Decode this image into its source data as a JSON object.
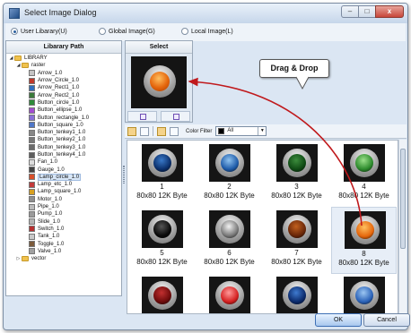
{
  "window": {
    "title": "Select Image Dialog",
    "controls": {
      "minimize": "–",
      "maximize": "□",
      "close": "x"
    }
  },
  "library_options": [
    {
      "label": "User Libarary(U)",
      "selected": true
    },
    {
      "label": "Global Image(G)",
      "selected": false
    },
    {
      "label": "Local Image(L)",
      "selected": false
    }
  ],
  "left_pane": {
    "header": "Libarary Path",
    "tree": [
      {
        "label": "LIBRARY",
        "indent": 0,
        "toggle": "◢",
        "type": "folder"
      },
      {
        "label": "raster",
        "indent": 1,
        "toggle": "◢",
        "type": "folder"
      },
      {
        "label": "Arrow_1.0",
        "indent": 2,
        "type": "item",
        "color": "#c4c4c4"
      },
      {
        "label": "Arrow_Circle_1.0",
        "indent": 2,
        "type": "item",
        "color": "#c0392b"
      },
      {
        "label": "Arrow_Rect1_1.0",
        "indent": 2,
        "type": "item",
        "color": "#2f6fbf"
      },
      {
        "label": "Arrow_Rect2_1.0",
        "indent": 2,
        "type": "item",
        "color": "#3a7a3a"
      },
      {
        "label": "Button_circle_1.0",
        "indent": 2,
        "type": "item",
        "color": "#2e8b3a"
      },
      {
        "label": "Button_ellipse_1.0",
        "indent": 2,
        "type": "item",
        "color": "#a24dd0"
      },
      {
        "label": "Button_rectangle_1.0",
        "indent": 2,
        "type": "item",
        "color": "#8a6fd8"
      },
      {
        "label": "Button_square_1.0",
        "indent": 2,
        "type": "item",
        "color": "#5078c8"
      },
      {
        "label": "Button_tenkey1_1.0",
        "indent": 2,
        "type": "item",
        "color": "#888888"
      },
      {
        "label": "Button_tenkey2_1.0",
        "indent": 2,
        "type": "item",
        "color": "#777777"
      },
      {
        "label": "Button_tenkey3_1.0",
        "indent": 2,
        "type": "item",
        "color": "#6a6a6a"
      },
      {
        "label": "Button_tenkey4_1.0",
        "indent": 2,
        "type": "item",
        "color": "#5d5d5d"
      },
      {
        "label": "Fan_1.0",
        "indent": 2,
        "type": "item",
        "color": "#dcdcdc"
      },
      {
        "label": "Gauge_1.0",
        "indent": 2,
        "type": "item",
        "color": "#444444"
      },
      {
        "label": "Lamp_circle_1.0",
        "indent": 2,
        "type": "item",
        "color": "#d94f2a",
        "selected": true
      },
      {
        "label": "Lamp_etc_1.0",
        "indent": 2,
        "type": "item",
        "color": "#c23a3a"
      },
      {
        "label": "Lamp_square_1.0",
        "indent": 2,
        "type": "item",
        "color": "#d8a020"
      },
      {
        "label": "Motor_1.0",
        "indent": 2,
        "type": "item",
        "color": "#8e8e8e"
      },
      {
        "label": "Pipe_1.0",
        "indent": 2,
        "type": "item",
        "color": "#bbbbbb"
      },
      {
        "label": "Pump_1.0",
        "indent": 2,
        "type": "item",
        "color": "#9a9a9a"
      },
      {
        "label": "Slide_1.0",
        "indent": 2,
        "type": "item",
        "color": "#b5b5b5"
      },
      {
        "label": "Switch_1.0",
        "indent": 2,
        "type": "item",
        "color": "#b83030"
      },
      {
        "label": "Tank_1.0",
        "indent": 2,
        "type": "item",
        "color": "#c9c9c9"
      },
      {
        "label": "Toggle_1.0",
        "indent": 2,
        "type": "item",
        "color": "#7b5a3a"
      },
      {
        "label": "Valve_1.0",
        "indent": 2,
        "type": "item",
        "color": "#a0a0a0"
      },
      {
        "label": "vector",
        "indent": 1,
        "toggle": "▷",
        "type": "folder"
      }
    ]
  },
  "select_panel": {
    "header": "Select",
    "preview_color": "orange"
  },
  "annotation": {
    "text": "Drag & Drop"
  },
  "toolbar": {
    "color_filter_label": "Color Filter",
    "filter_value": "All"
  },
  "grid": {
    "items": [
      {
        "number": "1",
        "size": "80x80 12K Byte",
        "color": "#0b2f6b",
        "highlight": "#3a79c8"
      },
      {
        "number": "2",
        "size": "80x80 12K Byte",
        "color": "#1d5aa8",
        "highlight": "#8fc3f0"
      },
      {
        "number": "3",
        "size": "80x80 12K Byte",
        "color": "#0f4a14",
        "highlight": "#3c8c3c"
      },
      {
        "number": "4",
        "size": "80x80 12K Byte",
        "color": "#2c8a2c",
        "highlight": "#9be08a"
      },
      {
        "number": "5",
        "size": "80x80 12K Byte",
        "color": "#0a0a0a",
        "highlight": "#555555"
      },
      {
        "number": "6",
        "size": "80x80 12K Byte",
        "color": "#7a7a7a",
        "highlight": "#f2f2f2"
      },
      {
        "number": "7",
        "size": "80x80 12K Byte",
        "color": "#6a2708",
        "highlight": "#c2601e"
      },
      {
        "number": "8",
        "size": "80x80 12K Byte",
        "color": "#e5660c",
        "highlight": "#ffc060",
        "selected": true
      },
      {
        "number": "",
        "size": "",
        "color": "#6d0b0b",
        "highlight": "#c23030"
      },
      {
        "number": "",
        "size": "",
        "color": "#d42020",
        "highlight": "#ff9a9a"
      },
      {
        "number": "",
        "size": "",
        "color": "#0b2a6b",
        "highlight": "#3f7bd0"
      },
      {
        "number": "",
        "size": "",
        "color": "#2a62b8",
        "highlight": "#9cc6f2"
      }
    ]
  },
  "buttons": {
    "ok": "OK",
    "cancel": "Cancel"
  }
}
